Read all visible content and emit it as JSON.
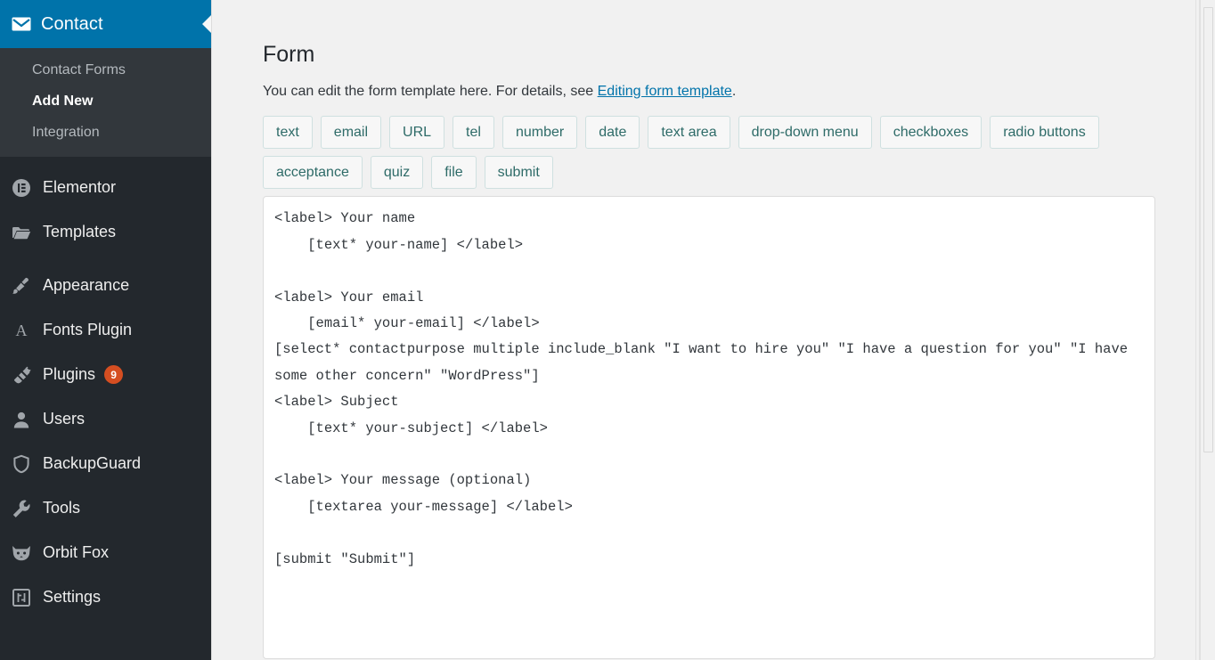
{
  "sidebar": {
    "active_menu": {
      "label": "Contact",
      "icon": "envelope-icon",
      "background_color": "#0073aa",
      "submenu": [
        {
          "label": "Contact Forms",
          "current": false
        },
        {
          "label": "Add New",
          "current": true
        },
        {
          "label": "Integration",
          "current": false
        }
      ]
    },
    "items": [
      {
        "label": "Elementor",
        "icon": "elementor-icon",
        "badge": null
      },
      {
        "label": "Templates",
        "icon": "folder-icon",
        "badge": null
      },
      {
        "label": "Appearance",
        "icon": "paintbrush-icon",
        "badge": null
      },
      {
        "label": "Fonts Plugin",
        "icon": "letter-a-icon",
        "badge": null
      },
      {
        "label": "Plugins",
        "icon": "plug-icon",
        "badge": "9"
      },
      {
        "label": "Users",
        "icon": "user-icon",
        "badge": null
      },
      {
        "label": "BackupGuard",
        "icon": "shield-icon",
        "badge": null
      },
      {
        "label": "Tools",
        "icon": "wrench-icon",
        "badge": null
      },
      {
        "label": "Orbit Fox",
        "icon": "fox-icon",
        "badge": null
      },
      {
        "label": "Settings",
        "icon": "settings-sliders-icon",
        "badge": null
      }
    ],
    "badge_color": "#d54e21"
  },
  "main": {
    "title": "Form",
    "description_before_link": "You can edit the form template here. For details, see ",
    "description_link": "Editing form template",
    "description_after_link": ".",
    "tag_rows": [
      [
        "text",
        "email",
        "URL",
        "tel",
        "number",
        "date",
        "text area",
        "drop-down menu",
        "checkboxes",
        "radio buttons"
      ],
      [
        "acceptance",
        "quiz",
        "file",
        "submit"
      ]
    ],
    "form_template": "<label> Your name\n    [text* your-name] </label>\n\n<label> Your email\n    [email* your-email] </label>\n[select* contactpurpose multiple include_blank \"I want to hire you\" \"I have a question for you\" \"I have some other concern\" \"WordPress\"]\n<label> Subject\n    [text* your-subject] </label>\n\n<label> Your message (optional)\n    [textarea your-message] </label>\n\n[submit \"Submit\"]"
  }
}
